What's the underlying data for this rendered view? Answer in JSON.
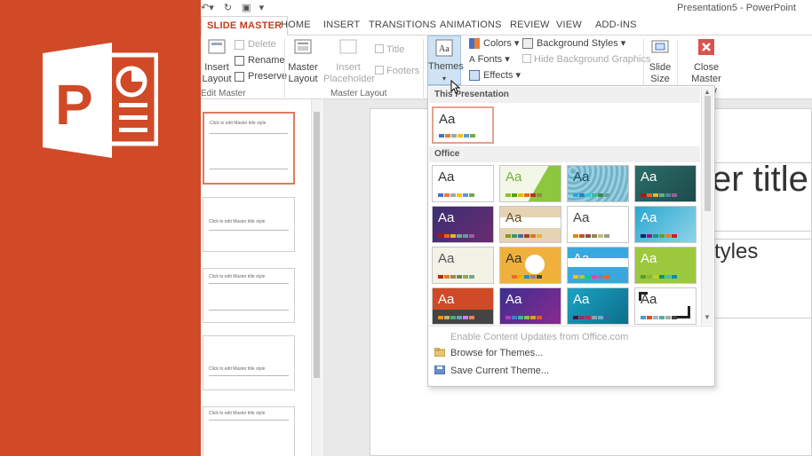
{
  "window": {
    "title": "Presentation5 - PowerPoint"
  },
  "tabs": [
    "SLIDE MASTER",
    "HOME",
    "INSERT",
    "TRANSITIONS",
    "ANIMATIONS",
    "REVIEW",
    "VIEW",
    "ADD-INS"
  ],
  "ribbon": {
    "insert_layout": "Insert\nLayout",
    "delete": "Delete",
    "rename": "Rename",
    "preserve": "Preserve",
    "edit_master_group": "Edit Master",
    "master_layout": "Master\nLayout",
    "insert_placeholder": "Insert\nPlaceholder",
    "title_chk": "Title",
    "footers_chk": "Footers",
    "master_layout_group": "Master Layout",
    "themes": "Themes",
    "colors": "Colors",
    "fonts": "Fonts",
    "effects": "Effects",
    "background_styles": "Background Styles",
    "hide_background_graphics": "Hide Background Graphics",
    "slide_size": "Slide\nSize",
    "close_master_view": "Close\nMaster View"
  },
  "themes_gallery": {
    "section_this": "This Presentation",
    "section_office": "Office",
    "tile_text": "Aa",
    "enable_updates": "Enable Content Updates from Office.com",
    "browse": "Browse for Themes...",
    "save": "Save Current Theme..."
  },
  "slide": {
    "title_fragment": "er title",
    "body_fragment": "tyles"
  },
  "thumbnails": {
    "t1": "Click to edit Master title style",
    "t2": "Click to edit Master title style",
    "t3": "Click to edit Master title style",
    "t4": "Click to edit Master title style",
    "t5": "Click to edit Master title style"
  },
  "colors": {
    "brand": "#d04a27",
    "accent": "#c43e1c"
  }
}
